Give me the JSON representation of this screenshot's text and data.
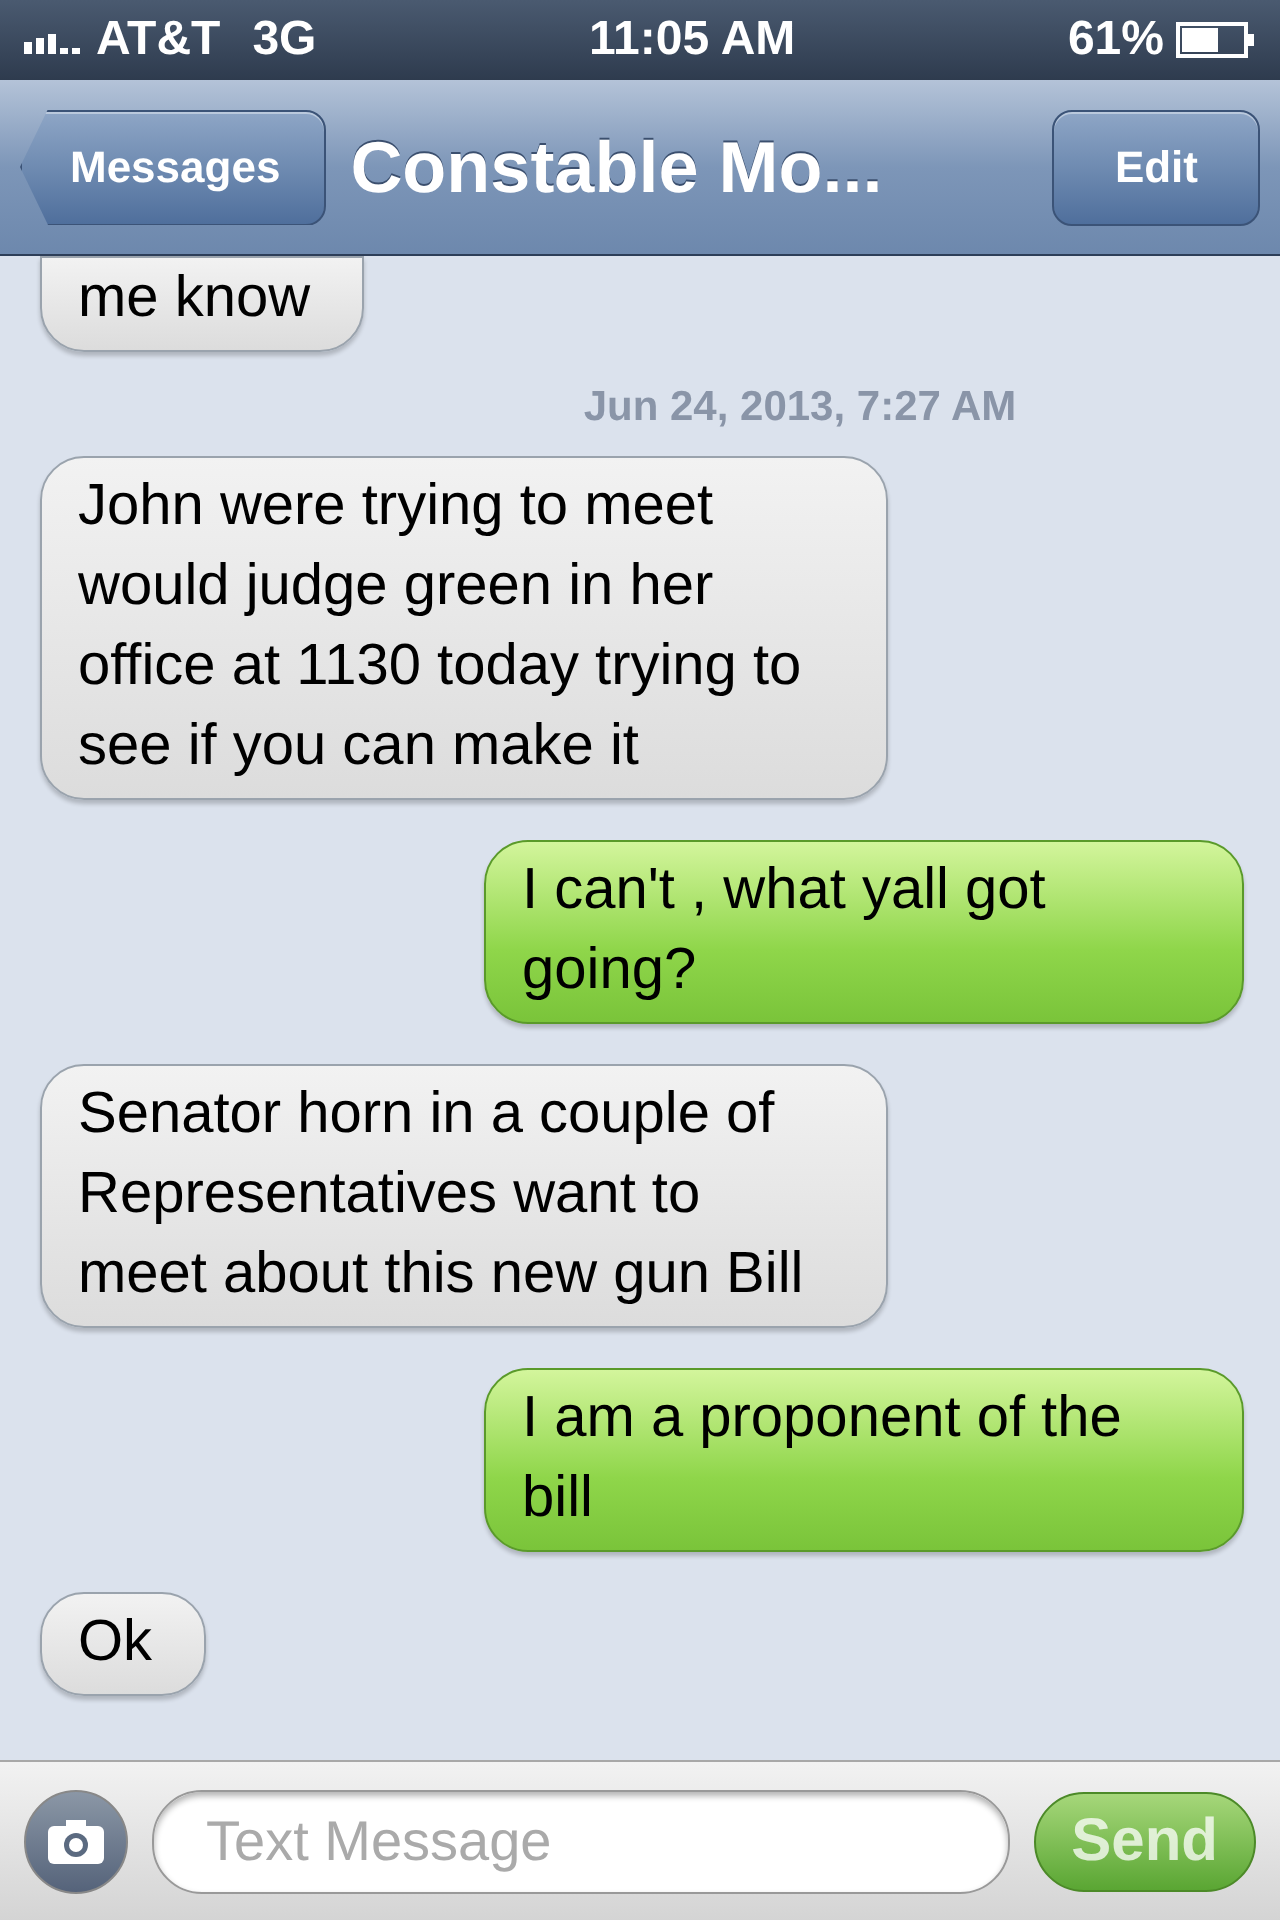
{
  "status_bar": {
    "carrier": "AT&T",
    "network": "3G",
    "time": "11:05 AM",
    "battery": "61%"
  },
  "nav_bar": {
    "back": "Messages",
    "title": "Constable Mo...",
    "action": "Edit"
  },
  "messages": [
    {
      "kind": "received",
      "text": "me know",
      "cut_top": true
    },
    {
      "kind": "timestamp",
      "text": "Jun 24, 2013, 7:27 AM"
    },
    {
      "kind": "received",
      "text": "John were trying to meet would judge green in her office at 1130 today trying to see if you can make it"
    },
    {
      "kind": "sent",
      "text": "I can't , what yall got going?"
    },
    {
      "kind": "received",
      "text": "Senator horn in a couple of Representatives want to meet about this new gun Bill"
    },
    {
      "kind": "sent",
      "text": "I am a proponent of the bill"
    },
    {
      "kind": "received",
      "text": "Ok"
    }
  ],
  "composer": {
    "placeholder": "Text Message",
    "send": "Send"
  }
}
